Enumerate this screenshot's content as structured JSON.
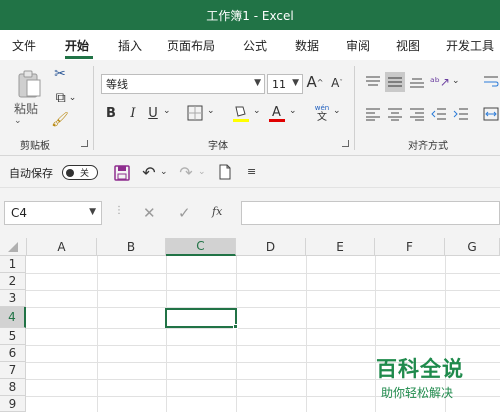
{
  "window": {
    "title": "工作簿1 - Excel"
  },
  "tabs": [
    "文件",
    "开始",
    "插入",
    "页面布局",
    "公式",
    "数据",
    "审阅",
    "视图",
    "开发工具"
  ],
  "active_tab": "开始",
  "ribbon": {
    "clipboard": {
      "paste_label": "粘贴",
      "group_label": "剪贴板"
    },
    "font": {
      "font_name": "等线",
      "font_size": "11",
      "bold": "B",
      "italic": "I",
      "underline": "U",
      "grow": "A",
      "shrink": "A",
      "wen_top": "wén",
      "wen_bottom": "文",
      "group_label": "字体"
    },
    "alignment": {
      "group_label": "对齐方式"
    }
  },
  "qat": {
    "autosave_label": "自动保存",
    "autosave_state": "关"
  },
  "formula_bar": {
    "name_box": "C4",
    "fx_label": "fx",
    "value": ""
  },
  "sheet": {
    "columns": [
      "A",
      "B",
      "C",
      "D",
      "E",
      "F",
      "G"
    ],
    "rows": [
      "1",
      "2",
      "3",
      "4",
      "5",
      "6",
      "7",
      "8",
      "9"
    ],
    "selected_column": "C",
    "selected_row": "4"
  },
  "watermark": {
    "title": "百科全说",
    "subtitle": "助你轻松解决"
  },
  "colors": {
    "accent": "#217346",
    "watermark": "#1f8a4c"
  }
}
